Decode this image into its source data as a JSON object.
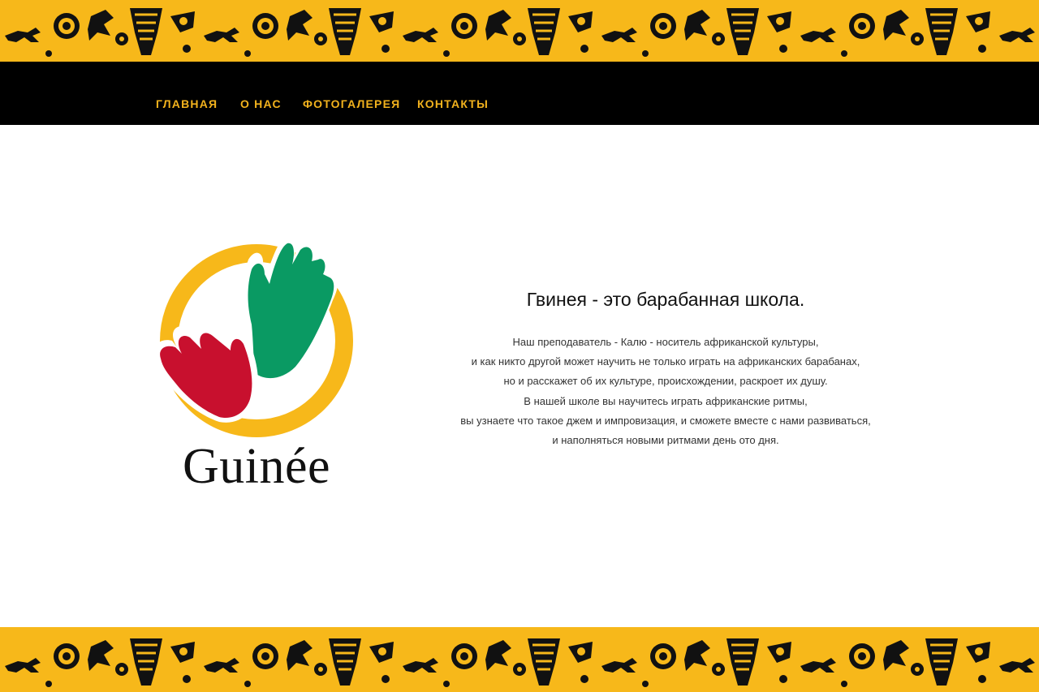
{
  "nav": {
    "items": [
      {
        "label": "ГЛАВНАЯ"
      },
      {
        "label": "О НАС"
      },
      {
        "label": "ФОТОГАЛЕРЕЯ"
      },
      {
        "label": "КОНТАКТЫ"
      }
    ]
  },
  "logo": {
    "wordmark": "Guinée"
  },
  "main": {
    "headline": "Гвинея - это барабанная школа.",
    "paragraph_lines": [
      "Наш преподаватель - Калю - носитель африканской культуры,",
      "и как никто другой может научить не только играть на африканских барабанах,",
      "но и расскажет об их культуре, происхождении, раскроет их душу.",
      "В нашей школе вы научитесь играть африканские ритмы,",
      "вы узнаете что такое джем и импровизация, и сможете вместе с нами развиваться,",
      "и наполняться новыми ритмами день ото дня."
    ]
  },
  "colors": {
    "ornament_bg": "#f7b81a",
    "nav_bg": "#000000",
    "nav_text": "#f2b21d",
    "logo_green": "#0a9a63",
    "logo_red": "#c8102e",
    "logo_yellow": "#f7b81a"
  }
}
